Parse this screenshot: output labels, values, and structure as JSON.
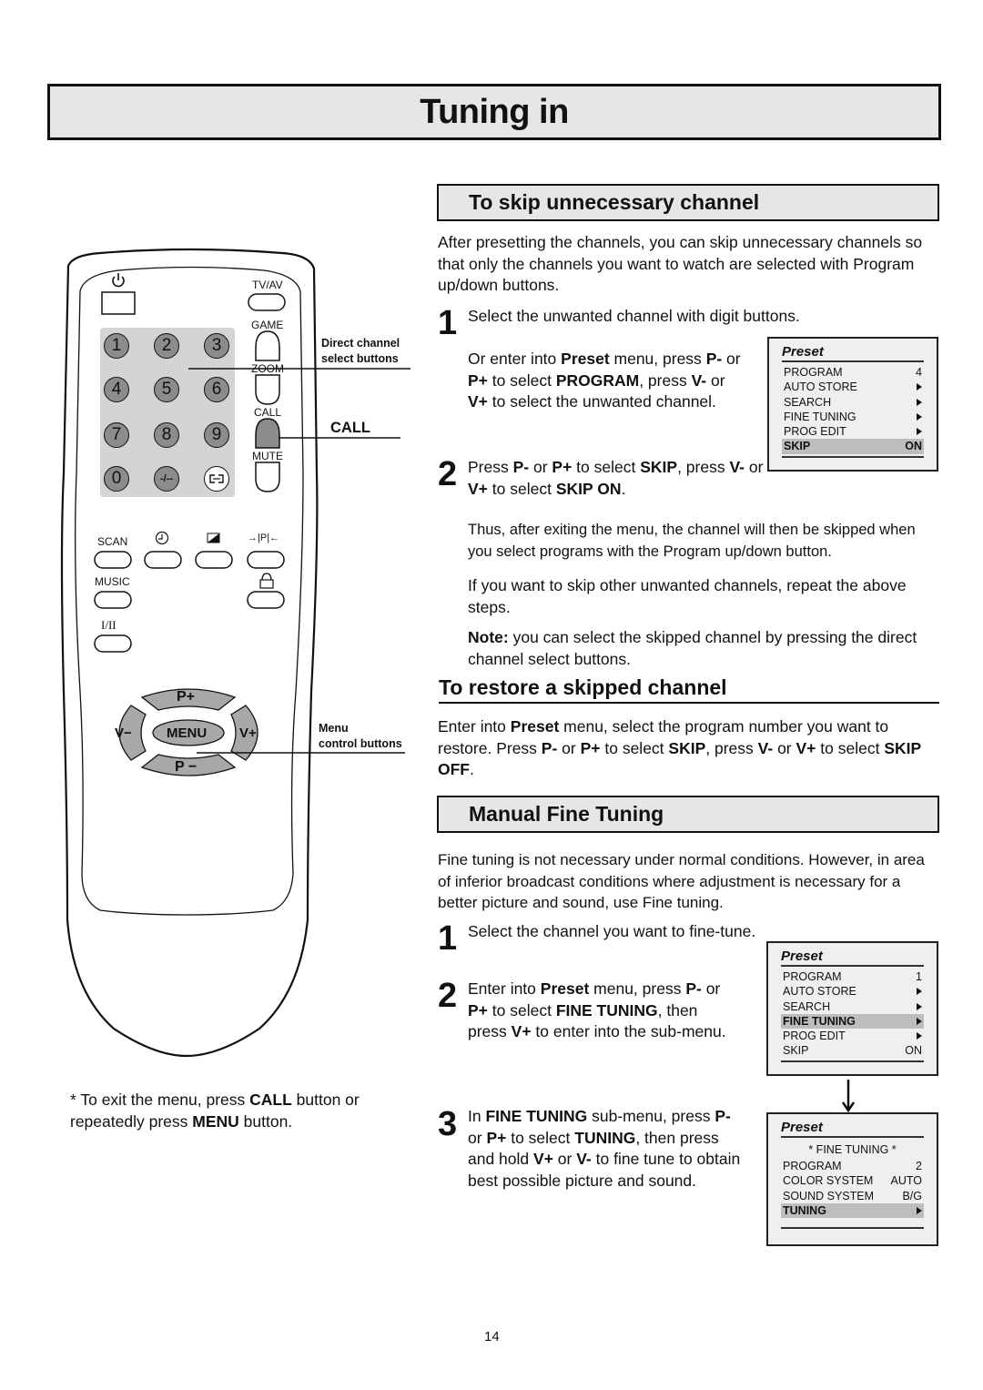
{
  "page": {
    "title": "Tuning in",
    "page_number": "14"
  },
  "remote": {
    "power_icon": "power-icon",
    "labels": {
      "tvav": "TV/AV",
      "game": "GAME",
      "zoom": "ZOOM",
      "call": "CALL",
      "mute": "MUTE",
      "scan": "SCAN",
      "music": "MUSIC",
      "dual": "I/II"
    },
    "digits": [
      "1",
      "2",
      "3",
      "4",
      "5",
      "6",
      "7",
      "8",
      "9",
      "0",
      "-/--"
    ],
    "icons": [
      "clock-icon",
      "picture-mode-icon",
      "swap-program-icon",
      "lock-icon",
      "teletext-icon"
    ],
    "swap_label": "→|P|←",
    "nav": {
      "p_plus": "P+",
      "p_minus": "P −",
      "v_minus": "V−",
      "v_plus": "V+",
      "menu": "MENU"
    },
    "callouts": {
      "direct_channel": [
        "Direct channel",
        "select buttons"
      ],
      "call": "CALL",
      "menu_control": [
        "Menu",
        "control buttons"
      ]
    }
  },
  "footnote": {
    "parts": [
      "* To exit the menu, press ",
      "CALL",
      " button or repeatedly press ",
      "MENU",
      " button."
    ]
  },
  "skip_section": {
    "heading": "To skip unnecessary channel",
    "intro": "After presetting the channels, you can skip unnecessary channels so that only the channels you want to watch are selected with Program up/down buttons.",
    "step1_num": "1",
    "step1": "Select the unwanted channel with digit buttons.",
    "step1_alt": [
      "Or enter into ",
      "Preset",
      " menu, press ",
      "P-",
      " or ",
      "P+",
      " to select ",
      "PROGRAM",
      ", press ",
      "V-",
      " or ",
      "V+",
      " to select the unwanted channel."
    ],
    "step2_num": "2",
    "step2": [
      "Press ",
      "P-",
      " or ",
      "P+",
      " to select ",
      "SKIP",
      ", press ",
      "V-",
      " or ",
      "V+",
      " to select ",
      "SKIP ON",
      "."
    ],
    "result": "Thus, after exiting the menu, the channel will then be skipped when you select programs with the Program up/down button.",
    "repeat": "If you want to skip other unwanted channels, repeat the above steps.",
    "note_label": "Note:",
    "note": " you can select the skipped channel by pressing the direct channel select buttons.",
    "osd": {
      "title": "Preset",
      "rows": [
        {
          "label": "PROGRAM",
          "value": "4",
          "arrow": false,
          "highlight": false
        },
        {
          "label": "AUTO STORE",
          "value": "",
          "arrow": true,
          "highlight": false
        },
        {
          "label": "SEARCH",
          "value": "",
          "arrow": true,
          "highlight": false
        },
        {
          "label": "FINE TUNING",
          "value": "",
          "arrow": true,
          "highlight": false
        },
        {
          "label": "PROG EDIT",
          "value": "",
          "arrow": true,
          "highlight": false
        },
        {
          "label": "SKIP",
          "value": "ON",
          "arrow": false,
          "highlight": true
        }
      ]
    }
  },
  "restore_section": {
    "heading": "To restore a skipped channel",
    "body": [
      "Enter into ",
      "Preset",
      " menu, select the program number you want to restore. Press ",
      "P-",
      " or ",
      "P+",
      " to select ",
      "SKIP",
      ", press ",
      "V-",
      " or ",
      "V+",
      " to select ",
      "SKIP OFF",
      "."
    ]
  },
  "fine_section": {
    "heading": "Manual Fine Tuning",
    "intro": "Fine tuning is not necessary under normal conditions. However, in area of inferior broadcast conditions where adjustment is necessary for a better picture and sound, use Fine tuning.",
    "step1_num": "1",
    "step1": "Select the channel you want to fine-tune.",
    "step2_num": "2",
    "step2": [
      "Enter into ",
      "Preset",
      " menu, press ",
      "P-",
      " or ",
      "P+",
      " to select ",
      "FINE TUNING",
      ", then press ",
      "V+",
      " to enter into the sub-menu."
    ],
    "step3_num": "3",
    "step3": [
      "In ",
      "FINE TUNING",
      " sub-menu, press ",
      "P-",
      " or ",
      "P+",
      " to select ",
      "TUNING",
      ", then press and hold ",
      "V+",
      " or ",
      "V-",
      " to fine tune to obtain best possible picture and sound."
    ],
    "arrow_icon": "arrow-down-icon",
    "osd1": {
      "title": "Preset",
      "rows": [
        {
          "label": "PROGRAM",
          "value": "1",
          "arrow": false,
          "highlight": false
        },
        {
          "label": "AUTO STORE",
          "value": "",
          "arrow": true,
          "highlight": false
        },
        {
          "label": "SEARCH",
          "value": "",
          "arrow": true,
          "highlight": false
        },
        {
          "label": "FINE TUNING",
          "value": "",
          "arrow": true,
          "highlight": true
        },
        {
          "label": "PROG EDIT",
          "value": "",
          "arrow": true,
          "highlight": false
        },
        {
          "label": "SKIP",
          "value": "ON",
          "arrow": false,
          "highlight": false
        }
      ]
    },
    "osd2": {
      "title": "Preset",
      "subtitle": "* FINE TUNING *",
      "rows": [
        {
          "label": "PROGRAM",
          "value": "2",
          "arrow": false,
          "highlight": false
        },
        {
          "label": "COLOR SYSTEM",
          "value": "AUTO",
          "arrow": false,
          "highlight": false
        },
        {
          "label": "SOUND SYSTEM",
          "value": "B/G",
          "arrow": false,
          "highlight": false
        },
        {
          "label": "TUNING",
          "value": "",
          "arrow": true,
          "highlight": true
        }
      ]
    }
  }
}
